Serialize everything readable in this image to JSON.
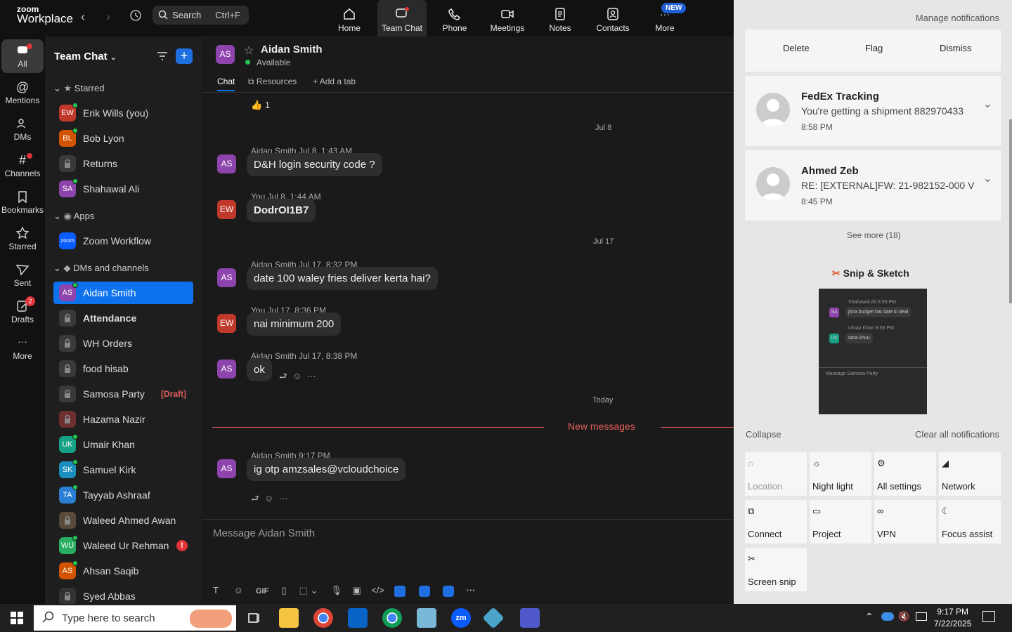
{
  "topbar": {
    "logo_line1": "zoom",
    "logo_line2": "Workplace",
    "search_label": "Search",
    "search_shortcut": "Ctrl+F",
    "nav": [
      {
        "label": "Home",
        "icon": "home-icon"
      },
      {
        "label": "Team Chat",
        "icon": "chat-icon"
      },
      {
        "label": "Phone",
        "icon": "phone-icon"
      },
      {
        "label": "Meetings",
        "icon": "video-icon"
      },
      {
        "label": "Notes",
        "icon": "notes-icon"
      },
      {
        "label": "Contacts",
        "icon": "contacts-icon"
      },
      {
        "label": "More",
        "icon": "more-icon"
      }
    ],
    "new_badge": "NEW"
  },
  "rail": {
    "items": [
      {
        "label": "All"
      },
      {
        "label": "Mentions"
      },
      {
        "label": "DMs"
      },
      {
        "label": "Channels"
      },
      {
        "label": "Bookmarks"
      },
      {
        "label": "Starred"
      },
      {
        "label": "Sent"
      },
      {
        "label": "Drafts",
        "badge": "2"
      },
      {
        "label": "More"
      }
    ]
  },
  "sidebar": {
    "title": "Team Chat",
    "sections": {
      "starred": "Starred",
      "apps": "Apps",
      "dms": "DMs and channels"
    },
    "starred": [
      {
        "initials": "EW",
        "name": "Erik Wills (you)",
        "color": "#c0392b"
      },
      {
        "initials": "BL",
        "name": "Bob Lyon",
        "color": "#d35400"
      },
      {
        "initials": "",
        "name": "Returns",
        "color": "#3a3a3a"
      },
      {
        "initials": "SA",
        "name": "Shahawal Ali",
        "color": "#8e44ad"
      }
    ],
    "apps": [
      {
        "initials": "zoom",
        "name": "Zoom Workflow",
        "color": "#0b5cff"
      }
    ],
    "dms": [
      {
        "initials": "AS",
        "name": "Aidan Smith",
        "color": "#8e44ad",
        "selected": true
      },
      {
        "initials": "",
        "name": "Attendance",
        "color": "#3a3a3a",
        "bold": true
      },
      {
        "initials": "",
        "name": "WH Orders",
        "color": "#3a3a3a"
      },
      {
        "initials": "",
        "name": "food hisab",
        "color": "#3a3a3a"
      },
      {
        "initials": "",
        "name": "Samosa Party",
        "color": "#3a3a3a",
        "draft": "[Draft]"
      },
      {
        "initials": "",
        "name": "Hazama Nazir",
        "color": "#6d2f2f"
      },
      {
        "initials": "UK",
        "name": "Umair Khan",
        "color": "#16a085"
      },
      {
        "initials": "SK",
        "name": "Samuel Kirk",
        "color": "#1a8fbf"
      },
      {
        "initials": "TA",
        "name": "Tayyab Ashraaf",
        "color": "#2a7fd4"
      },
      {
        "initials": "",
        "name": "Waleed Ahmed Awan",
        "color": "#5a4a3a"
      },
      {
        "initials": "WU",
        "name": "Waleed Ur Rehman",
        "color": "#27ae60",
        "alert": "!"
      },
      {
        "initials": "AS",
        "name": "Ahsan Saqib",
        "color": "#d35400"
      },
      {
        "initials": "",
        "name": "Syed Abbas",
        "color": "#333"
      }
    ]
  },
  "chat": {
    "contact": "Aidan Smith",
    "initials": "AS",
    "status": "Available",
    "tabs": {
      "chat": "Chat",
      "resources": "Resources",
      "add": "Add a tab"
    },
    "reaction": "1",
    "messages": [
      {
        "type": "date",
        "text": "Jul 8"
      },
      {
        "initials": "AS",
        "color": "#8e44ad",
        "meta": "Aidan Smith Jul 8, 1:43 AM",
        "text": "D&H login security code ?"
      },
      {
        "initials": "EW",
        "color": "#c0392b",
        "meta": "You Jul 8, 1:44 AM",
        "text": "DodrOI1B7",
        "bold": true
      },
      {
        "type": "date",
        "text": "Jul 17"
      },
      {
        "initials": "AS",
        "color": "#8e44ad",
        "meta": "Aidan Smith Jul 17, 8:32 PM",
        "text": "date 100 waley fries deliver kerta hai?"
      },
      {
        "initials": "EW",
        "color": "#c0392b",
        "meta": "You Jul 17, 8:36 PM",
        "text": "nai minimum 200"
      },
      {
        "initials": "AS",
        "color": "#8e44ad",
        "meta": "Aidan Smith Jul 17, 8:38 PM",
        "text": "ok"
      },
      {
        "type": "date",
        "text": "Today"
      },
      {
        "type": "new",
        "text": "New messages"
      },
      {
        "initials": "AS",
        "color": "#8e44ad",
        "meta": "Aidan Smith 9:17 PM",
        "text": "ig otp amzsales@vcloudchoice"
      }
    ],
    "composer_placeholder": "Message Aidan Smith"
  },
  "notifications": {
    "manage": "Manage notifications",
    "actions": [
      "Delete",
      "Flag",
      "Dismiss"
    ],
    "cards": [
      {
        "title": "FedEx Tracking",
        "body": "You're getting a shipment 882970433",
        "time": "8:58 PM"
      },
      {
        "title": "Ahmed Zeb",
        "body": "RE: [EXTERNAL]FW: 21-982152-000 V",
        "time": "8:45 PM"
      }
    ],
    "see_more": "See more (18)",
    "snip_title": "Snip & Sketch",
    "snip_preview": {
      "m1_meta": "Shahawal Ali 8:55 PM",
      "m1_text": "jitna budget hai date ki deal",
      "m2_meta": "Umair Khan 8:56 PM",
      "m2_text": "tatta khuu",
      "composer": "Message Samosa Party"
    },
    "collapse": "Collapse",
    "clear_all": "Clear all notifications",
    "quick": [
      "Location",
      "Night light",
      "All settings",
      "Network",
      "Connect",
      "Project",
      "VPN",
      "Focus assist",
      "Screen snip"
    ]
  },
  "taskbar": {
    "search_placeholder": "Type here to search",
    "time": "9:17 PM",
    "date": "7/22/2025"
  }
}
